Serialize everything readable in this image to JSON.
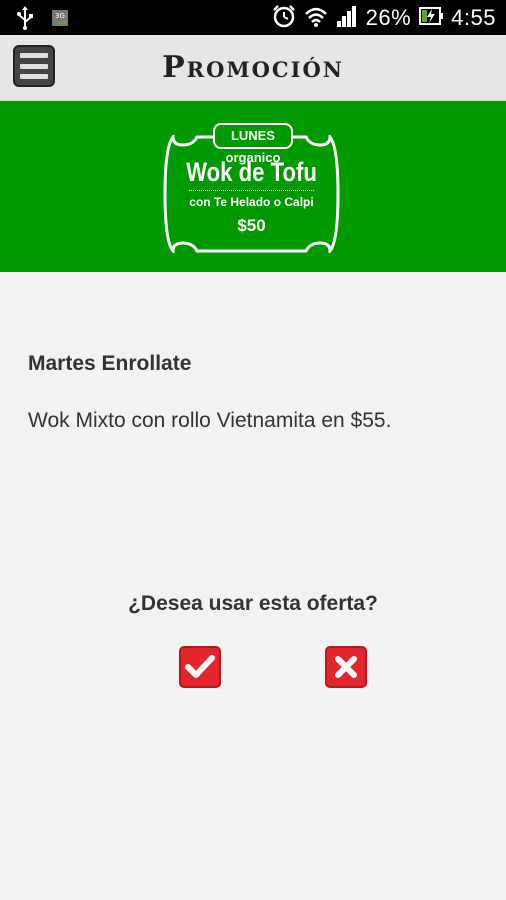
{
  "status_bar": {
    "battery_percent": "26%",
    "time": "4:55",
    "network_badge": "3G",
    "icons": [
      "usb-icon",
      "network-3g-icon",
      "alarm-icon",
      "wifi-icon",
      "signal-icon",
      "battery-icon"
    ]
  },
  "app_bar": {
    "title": "Promoción",
    "menu_icon": "hamburger-menu-icon"
  },
  "banner": {
    "tag": "LUNES organico",
    "title": "Wok de Tofu",
    "subtitle": "con Te Helado o Calpi",
    "price": "$50",
    "background_color": "#009900"
  },
  "promo": {
    "title": "Martes Enrollate",
    "description": "Wok Mixto con rollo Vietnamita en $55."
  },
  "confirm": {
    "question": "¿Desea usar esta oferta?",
    "accept_icon": "checkmark-icon",
    "reject_icon": "close-icon",
    "button_color": "#e3262e"
  }
}
